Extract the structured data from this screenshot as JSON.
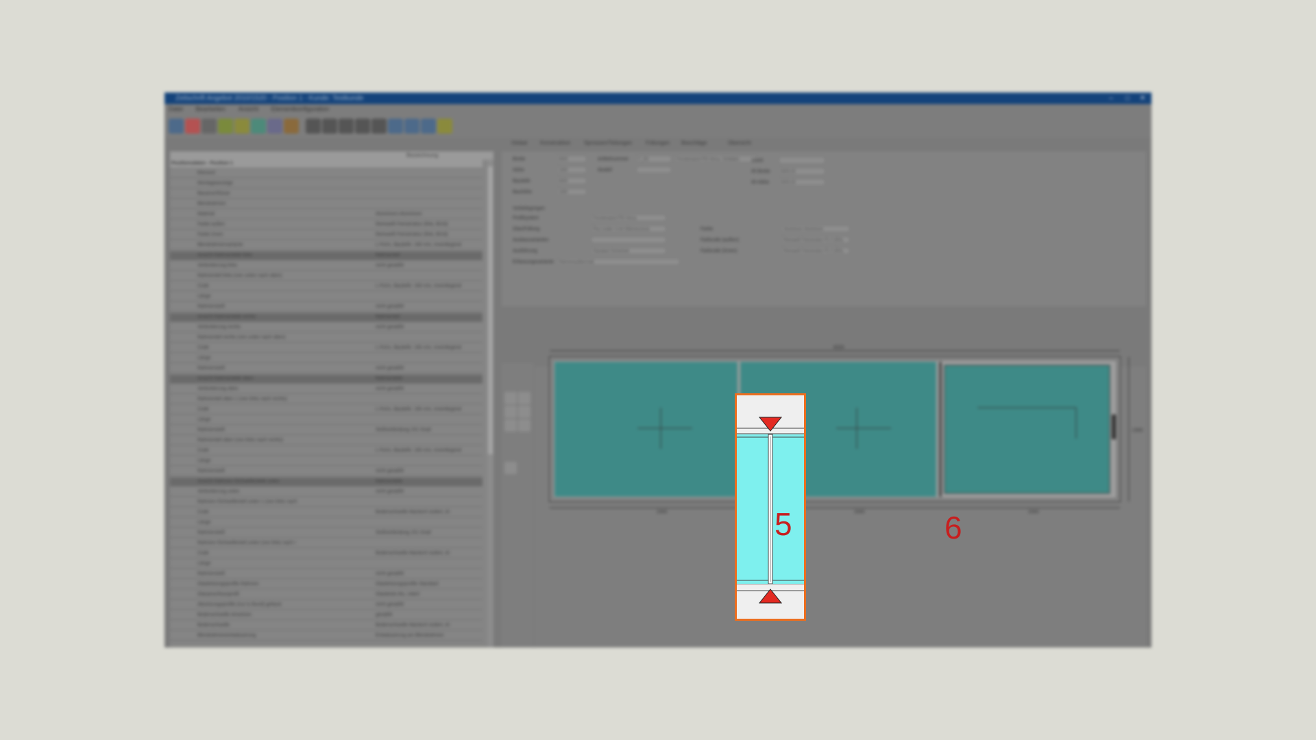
{
  "window": {
    "title": "Zeitschrift Angebot 2010/1520 - Position 1 - Kunde: Testkunde",
    "buttons": {
      "minimize": "–",
      "maximize": "□",
      "close": "✕"
    }
  },
  "menu": [
    "Datei",
    "Bearbeiten",
    "Ansicht",
    "Elementkonfiguration"
  ],
  "toolbar_icons": [
    "settings-icon",
    "target-icon",
    "wand-icon",
    "brush-icon",
    "pencil-icon",
    "palette-icon",
    "document-icon",
    "color-drops-icon",
    "first-icon",
    "prev-icon",
    "record-icon",
    "next-icon",
    "last-icon",
    "grid-icon",
    "chart-icon",
    "export-icon",
    "ruler-icon"
  ],
  "left_panel": {
    "header": "Bezeichnung",
    "title_row": "Positionsdaten - Position 1",
    "rows": [
      {
        "l": "Element",
        "r": "",
        "dark": false
      },
      {
        "l": "Montageanzeige",
        "r": "",
        "dark": false
      },
      {
        "l": "Bauanschlüsse",
        "r": "",
        "dark": false
      },
      {
        "l": "Blendrahmen",
        "r": "",
        "dark": false
      },
      {
        "l": "Material",
        "r": "Aluminium-Aluminium",
        "dark": false
      },
      {
        "l": "Farbe außen",
        "r": "Reinweiß Feinstruktur (RAL 9016)",
        "dark": false
      },
      {
        "l": "Farbe innen",
        "r": "Reinweiß Feinstruktur (RAL 9016)",
        "dark": false
      },
      {
        "l": "Blendrahmenvariante",
        "r": "L-Form, Bautiefe: 160 mm, innenliegend",
        "dark": false
      },
      {
        "l": "Ansicht Rahmenteile links",
        "r": "Rahmenteil",
        "dark": true
      },
      {
        "l": "Verbreiterung links",
        "r": "nicht gewählt",
        "dark": false
      },
      {
        "l": "Rahmenteil links (von unten nach oben)",
        "r": "",
        "dark": false
      },
      {
        "l": "Code",
        "r": "L-Form, Bautiefe: 160 mm, innenliegend",
        "dark": false
      },
      {
        "l": "Länge",
        "r": "",
        "dark": false
      },
      {
        "l": "Rahmenstoß",
        "r": "nicht gewählt",
        "dark": false
      },
      {
        "l": "Ansicht Rahmenteile rechts",
        "r": "Rahmenteil",
        "dark": true
      },
      {
        "l": "Verbreiterung rechts",
        "r": "nicht gewählt",
        "dark": false
      },
      {
        "l": "Rahmenteil rechts (von unten nach oben)",
        "r": "",
        "dark": false
      },
      {
        "l": "Code",
        "r": "L-Form, Bautiefe: 160 mm, innenliegend",
        "dark": false
      },
      {
        "l": "Länge",
        "r": "",
        "dark": false
      },
      {
        "l": "Rahmenstoß",
        "r": "nicht gewählt",
        "dark": false
      },
      {
        "l": "Ansicht Rahmenteile oben",
        "r": "Rahmenteile",
        "dark": true
      },
      {
        "l": "Verbreiterung oben",
        "r": "nicht gewählt",
        "dark": false
      },
      {
        "l": "Rahmenteil oben 1 (von links nach rechts)",
        "r": "",
        "dark": false
      },
      {
        "l": "Code",
        "r": "L-Form, Bautiefe: 160 mm, innenliegend",
        "dark": false
      },
      {
        "l": "Länge",
        "r": "",
        "dark": false
      },
      {
        "l": "Rahmenstoß",
        "r": "Stoßverbindung 151 Grad",
        "dark": false
      },
      {
        "l": "Rahmenteil oben (von links nach rechts)",
        "r": "",
        "dark": false
      },
      {
        "l": "Code",
        "r": "L-Form, Bautiefe: 160 mm, innenliegend",
        "dark": false
      },
      {
        "l": "Länge",
        "r": "",
        "dark": false
      },
      {
        "l": "Rahmenstoß",
        "r": "nicht gewählt",
        "dark": false
      },
      {
        "l": "Ansicht Rahmen-/Schwellenteile unten",
        "r": "Rahmenteile",
        "dark": true
      },
      {
        "l": "Verbreiterung unten",
        "r": "nicht gewählt",
        "dark": false
      },
      {
        "l": "Rahmen-/Schwellenteil unten 1 (von links nach",
        "r": "",
        "dark": false
      },
      {
        "l": "Code",
        "r": "Bodenschwelle Mantech isoliert, Al",
        "dark": false
      },
      {
        "l": "Länge",
        "r": "",
        "dark": false
      },
      {
        "l": "Rahmenstoß",
        "r": "Stoßverbindung 151 Grad",
        "dark": false
      },
      {
        "l": "Rahmen-/Schwellenteil unten (von links nach r",
        "r": "",
        "dark": false
      },
      {
        "l": "Code",
        "r": "Bodenschwelle Mantech isoliert, Al",
        "dark": false
      },
      {
        "l": "Länge",
        "r": "",
        "dark": false
      },
      {
        "l": "Rahmenstoß",
        "r": "nicht gewählt",
        "dark": false
      },
      {
        "l": "Glasleistungsprofile Rahmen",
        "r": "Glasleistungsprofile Standard",
        "dark": false
      },
      {
        "l": "Glasanschlussprofil",
        "r": "Glasleiste Alu, rotiert",
        "dark": false
      },
      {
        "l": "Absetzungsprofile (nur in Bund) gefasst",
        "r": "nicht gewählt",
        "dark": false
      },
      {
        "l": "Bodenschwelle einsetzen",
        "r": "gewählt",
        "dark": false
      },
      {
        "l": "Bodenschwelle",
        "r": "Bodenschwelle Mantech isoliert, Al",
        "dark": false
      },
      {
        "l": "Blendrahmenentwässerung",
        "r": "Entwässerung am Blendrahmen",
        "dark": false
      }
    ]
  },
  "tabs": [
    "Global",
    "Konstruktion",
    "Sprossen/Teilungen",
    "Füllungen",
    "Beschläge",
    "Übersicht"
  ],
  "form": {
    "labels_left": [
      "Breite",
      "Höhe",
      "Bautiefe",
      "Bauhöhe"
    ],
    "values_left": [
      "6000",
      "2300",
      "6000",
      "2300"
    ],
    "labels_mid": [
      "Artikelnummer",
      "Modell"
    ],
    "article_no": "F_SS",
    "article_desc": "Fensterwand PSI-Versa, Schieben",
    "labels_right": [
      "Stück",
      "IR-Breite",
      "IR-Höhe"
    ],
    "values_right": [
      "",
      "6000,00",
      "6000,00"
    ],
    "section": "Vorbelegungen",
    "sub_labels": [
      "Profilsystem",
      "Glas/Füllung",
      "Ausbauvarianten",
      "Ausführung",
      "Erfassungsvariante"
    ],
    "sub_values": [
      "Fensterwand PSI-Versa",
      "Plus-Isolier 3-mit Wärmeschutz",
      "",
      "Standard Sicherheit",
      "Rahmenaufbermaß"
    ],
    "sub_right_labels": [
      "Farbe",
      "Farbcode (außen)",
      "Farbcode (innen)"
    ],
    "sub_right_values": [
      "Aluminium-Aluminium",
      "Reinweiß Feinstruktur P1.0 (RAL",
      "Reinweiß Feinstruktur P1.0 (RAL"
    ]
  },
  "drawing": {
    "top_dimension": "6000",
    "bottom_dims": [
      "2000",
      "2000",
      "2000"
    ],
    "side_dimension": "2300",
    "glass_color": "#7ef0ee",
    "dim_glass_color": "#3e8a87"
  },
  "callouts": {
    "highlighted": "5",
    "other": "6"
  },
  "colors": {
    "highlight_border": "#ec6e1f",
    "marker": "#e32a22",
    "label": "#c81e1e"
  }
}
